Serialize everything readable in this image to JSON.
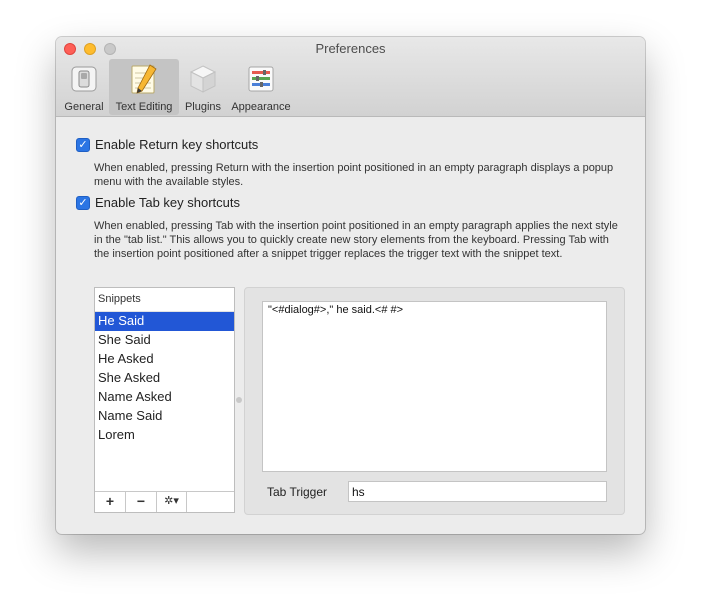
{
  "window": {
    "title": "Preferences"
  },
  "toolbar": {
    "items": [
      {
        "label": "General",
        "icon": "general-switch-icon"
      },
      {
        "label": "Text Editing",
        "icon": "pencil-notepad-icon",
        "selected": true
      },
      {
        "label": "Plugins",
        "icon": "plugin-cube-icon"
      },
      {
        "label": "Appearance",
        "icon": "appearance-sliders-icon"
      }
    ]
  },
  "options": {
    "return_shortcuts": {
      "label": "Enable Return key shortcuts",
      "checked": true,
      "description": "When enabled, pressing Return with the insertion point positioned in an empty paragraph displays a popup menu with the available styles."
    },
    "tab_shortcuts": {
      "label": "Enable Tab key shortcuts",
      "checked": true,
      "description": "When enabled, pressing Tab with the insertion point positioned in an empty paragraph applies the next style in the \"tab list.\" This allows you to quickly create new story elements from the keyboard. Pressing Tab with the insertion point positioned after a snippet trigger replaces the trigger text with the snippet text."
    }
  },
  "snippets": {
    "header": "Snippets",
    "items": [
      "He Said",
      "She Said",
      "He Asked",
      "She Asked",
      "Name Asked",
      "Name Said",
      "Lorem"
    ],
    "selected_index": 0,
    "buttons": {
      "add": "+",
      "remove": "−",
      "action": "✲▾"
    }
  },
  "editor": {
    "text": "\"<#dialog#>,\" he said.<# #>",
    "tab_trigger_label": "Tab Trigger",
    "tab_trigger_value": "hs"
  }
}
